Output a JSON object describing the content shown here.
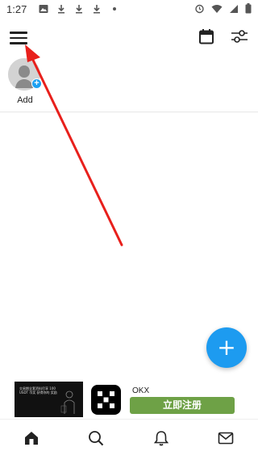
{
  "status_bar": {
    "time": "1:27",
    "icons": [
      "image-icon",
      "download-icon",
      "download-icon",
      "download-icon",
      "dot-icon"
    ],
    "right_icons": [
      "alarm-icon",
      "wifi-icon",
      "signal-icon",
      "battery-icon"
    ]
  },
  "app_bar": {
    "menu_icon": "hamburger-menu-icon",
    "calendar_icon": "calendar-icon",
    "filter_icon": "filter-settings-icon"
  },
  "stories": {
    "add_label": "Add"
  },
  "fab": {
    "label": "+"
  },
  "ad": {
    "image_text": "交易期全套资料尽享 100 USDT 币奖 获得你的 奖励",
    "brand": "OKX",
    "cta_label": "立即注册",
    "cta_color": "#6ea146"
  },
  "bottom_nav": {
    "items": [
      "home-icon",
      "search-icon",
      "notifications-icon",
      "messages-icon"
    ]
  },
  "colors": {
    "accent": "#1d9bf0",
    "annotation_arrow": "#e8201c"
  }
}
